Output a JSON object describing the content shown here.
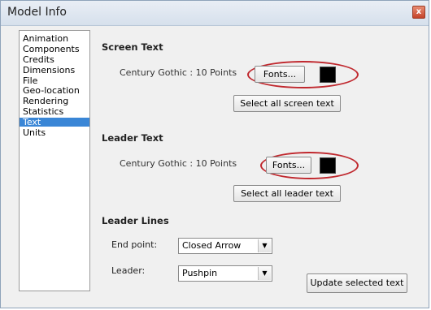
{
  "window": {
    "title": "Model Info",
    "close_glyph": "x"
  },
  "sidebar": {
    "items": [
      {
        "label": "Animation"
      },
      {
        "label": "Components"
      },
      {
        "label": "Credits"
      },
      {
        "label": "Dimensions"
      },
      {
        "label": "File"
      },
      {
        "label": "Geo-location"
      },
      {
        "label": "Rendering"
      },
      {
        "label": "Statistics"
      },
      {
        "label": "Text"
      },
      {
        "label": "Units"
      }
    ],
    "selected": "Text"
  },
  "screen_text": {
    "heading": "Screen Text",
    "font_info": "Century Gothic : 10 Points",
    "fonts_button": "Fonts...",
    "select_all_button": "Select all screen text",
    "color": "#000000"
  },
  "leader_text": {
    "heading": "Leader Text",
    "font_info": "Century Gothic : 10 Points",
    "fonts_button": "Fonts...",
    "select_all_button": "Select all leader text",
    "color": "#000000"
  },
  "leader_lines": {
    "heading": "Leader Lines",
    "end_point_label": "End point:",
    "end_point_value": "Closed Arrow",
    "leader_label": "Leader:",
    "leader_value": "Pushpin",
    "update_button": "Update selected text"
  },
  "colors": {
    "accent_selected": "#3a86d6",
    "highlight_oval": "#c0282e"
  }
}
